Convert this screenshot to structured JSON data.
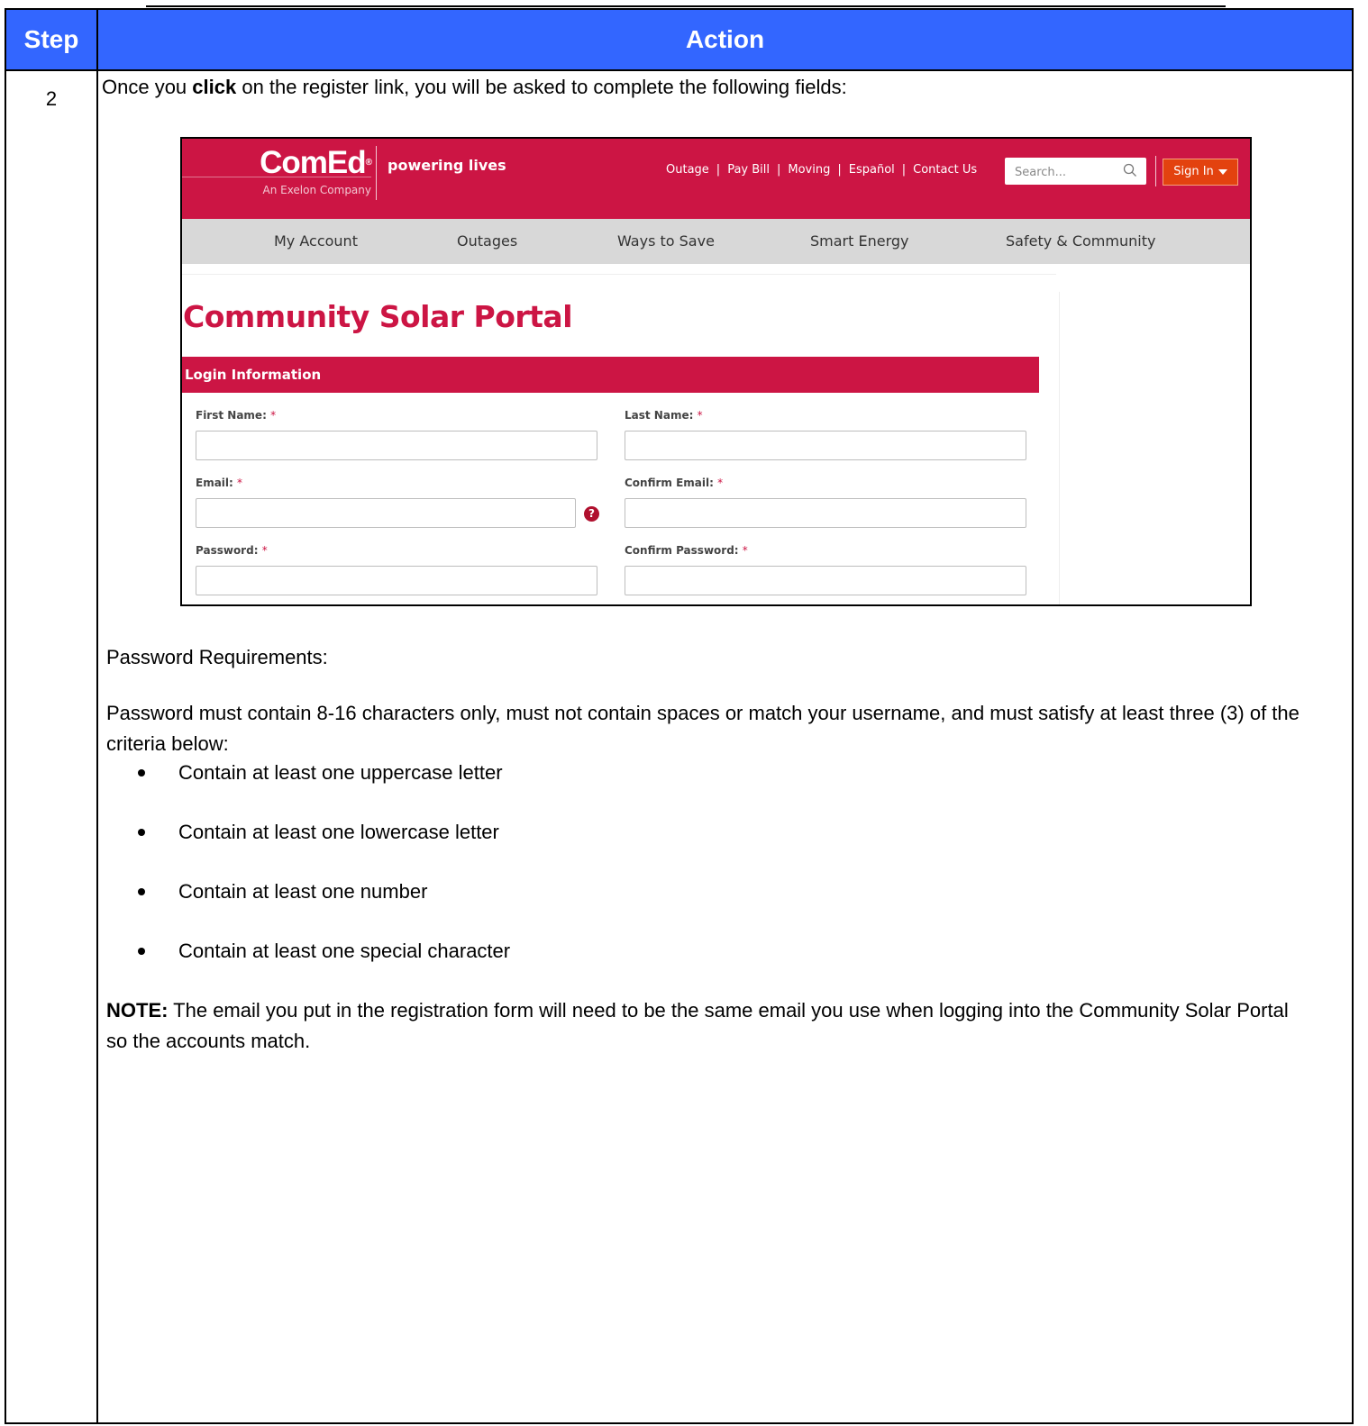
{
  "table": {
    "header_step": "Step",
    "header_action": "Action",
    "step_number": "2"
  },
  "intro": {
    "before": "Once you ",
    "bold": "click",
    "after": " on the register link, you will be asked to complete the following fields:"
  },
  "screenshot": {
    "logo_text": "ComEd",
    "logo_sub": "An Exelon Company",
    "tagline": "powering lives",
    "utility_nav": [
      "Outage",
      "Pay Bill",
      "Moving",
      "Español",
      "Contact Us"
    ],
    "search_placeholder": "Search...",
    "sign_in": "Sign In",
    "main_nav": [
      "My Account",
      "Outages",
      "Ways to Save",
      "Smart Energy",
      "Safety & Community"
    ],
    "page_title": "Community Solar Portal",
    "section_title": "Login Information",
    "fields": {
      "first_name": "First Name:",
      "last_name": "Last Name:",
      "email": "Email:",
      "confirm_email": "Confirm Email:",
      "password": "Password:",
      "confirm_password": "Confirm Password:",
      "required_mark": "*"
    },
    "help_symbol": "?",
    "colors": {
      "brand_red": "#cc1544",
      "sign_in_orange": "#e3420f",
      "nav_gray": "#d8d8d8"
    }
  },
  "requirements": {
    "heading": "Password Requirements:",
    "paragraph": "Password must contain 8-16 characters only, must not contain spaces or match your username, and must satisfy at least three (3) of the criteria below:",
    "criteria": [
      "Contain at least one uppercase letter",
      "Contain at least one lowercase letter",
      "Contain at least one number",
      "Contain at least one special character"
    ]
  },
  "note": {
    "label": "NOTE:",
    "text": " The email you put in the registration form will need to be the same email you use when logging into the Community Solar Portal so the accounts match."
  },
  "colors": {
    "header_blue": "#3366ff"
  }
}
